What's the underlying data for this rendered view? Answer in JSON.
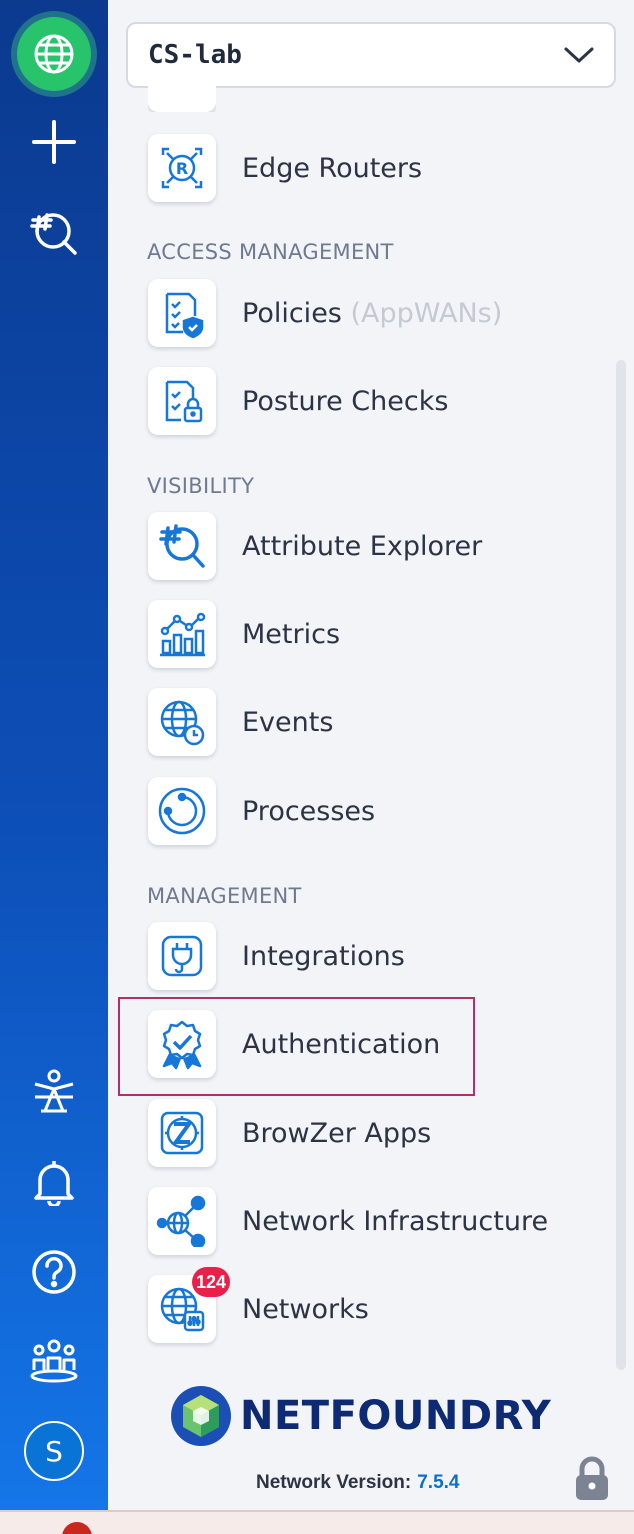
{
  "network_selector": {
    "value": "CS-lab"
  },
  "sections": {
    "access": "ACCESS MANAGEMENT",
    "visibility": "VISIBILITY",
    "management": "MANAGEMENT"
  },
  "items": {
    "edge_routers": "Edge Routers",
    "policies": "Policies",
    "policies_sub": "(AppWANs)",
    "posture_checks": "Posture Checks",
    "attribute_explorer": "Attribute Explorer",
    "metrics": "Metrics",
    "events": "Events",
    "processes": "Processes",
    "integrations": "Integrations",
    "authentication": "Authentication",
    "browzer_apps": "BrowZer Apps",
    "network_infrastructure": "Network Infrastructure",
    "networks": "Networks",
    "networks_badge": "124"
  },
  "rail": {
    "avatar_initial": "S"
  },
  "brand": {
    "logo_text": "NETFOUNDRY"
  },
  "footer": {
    "version_label": "Network Version:",
    "version_value": "7.5.4"
  },
  "icons": {
    "rail": [
      "globe-icon",
      "plus-icon",
      "attribute-search-icon",
      "ziti-icon",
      "bell-icon",
      "help-icon",
      "team-icon"
    ],
    "nav": [
      "edge-router-icon",
      "policy-icon",
      "posture-check-icon",
      "attribute-explorer-icon",
      "metrics-icon",
      "events-icon",
      "processes-icon",
      "integrations-icon",
      "authentication-icon",
      "browzer-icon",
      "network-infrastructure-icon",
      "networks-icon"
    ]
  },
  "colors": {
    "accent": "#0b6fcf",
    "badge": "#e8204a",
    "active_globe": "#27c46b",
    "highlight_border": "#b0306a"
  }
}
